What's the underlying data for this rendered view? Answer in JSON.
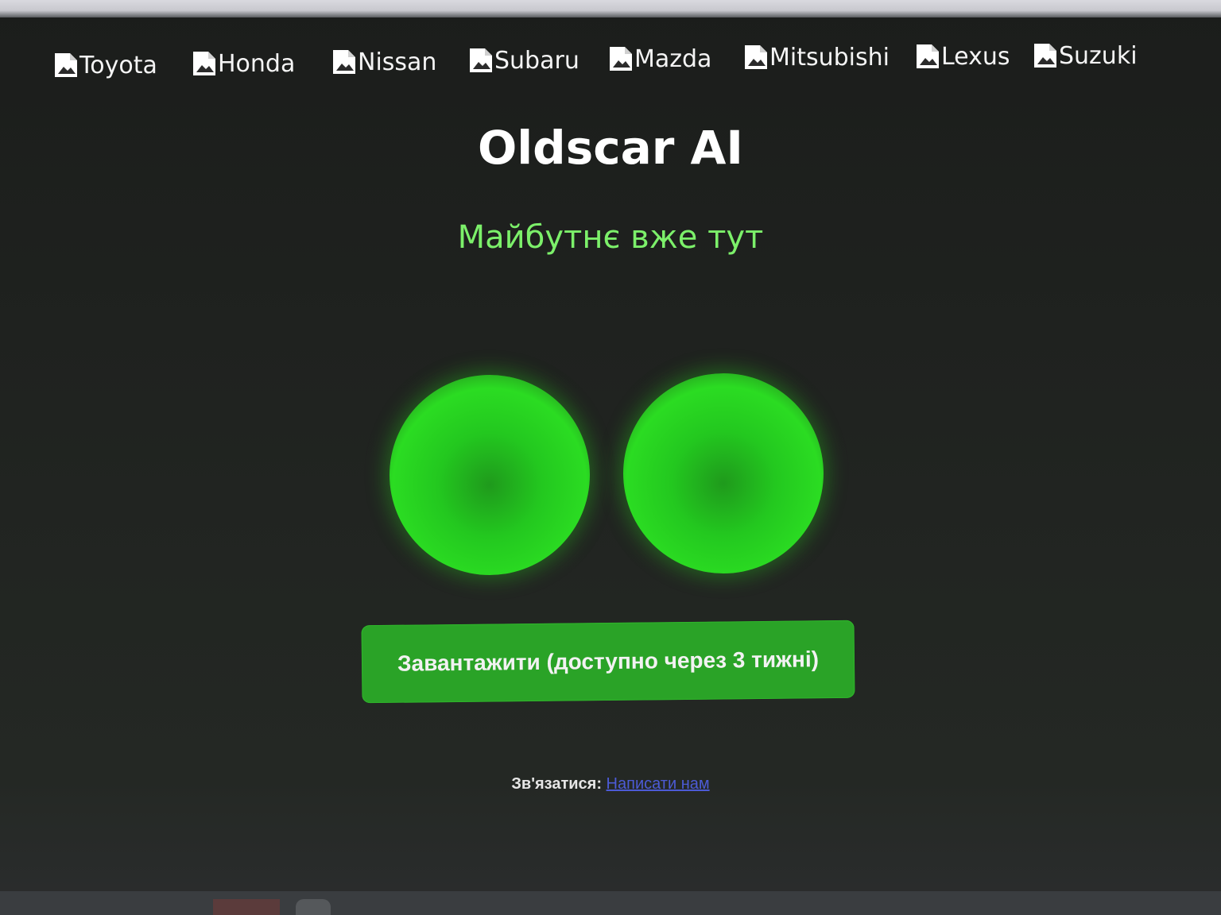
{
  "nav": {
    "items": [
      {
        "label": "Toyota"
      },
      {
        "label": "Honda"
      },
      {
        "label": "Nissan"
      },
      {
        "label": "Subaru"
      },
      {
        "label": "Mazda"
      },
      {
        "label": "Mitsubishi"
      },
      {
        "label": "Lexus"
      },
      {
        "label": "Suzuki"
      }
    ]
  },
  "hero": {
    "title": "Oldscar AI",
    "subtitle": "Майбутнє вже тут"
  },
  "cta": {
    "label": "Завантажити (доступно через 3 тижні)"
  },
  "contact": {
    "label": "Зв'язатися:",
    "link_text": "Написати нам"
  },
  "colors": {
    "background": "#1f1f1f",
    "accent_green": "#2aa327",
    "subtitle_green": "#7cf06a",
    "eye_green": "#2bdc22",
    "link_blue": "#4c5bd6"
  }
}
